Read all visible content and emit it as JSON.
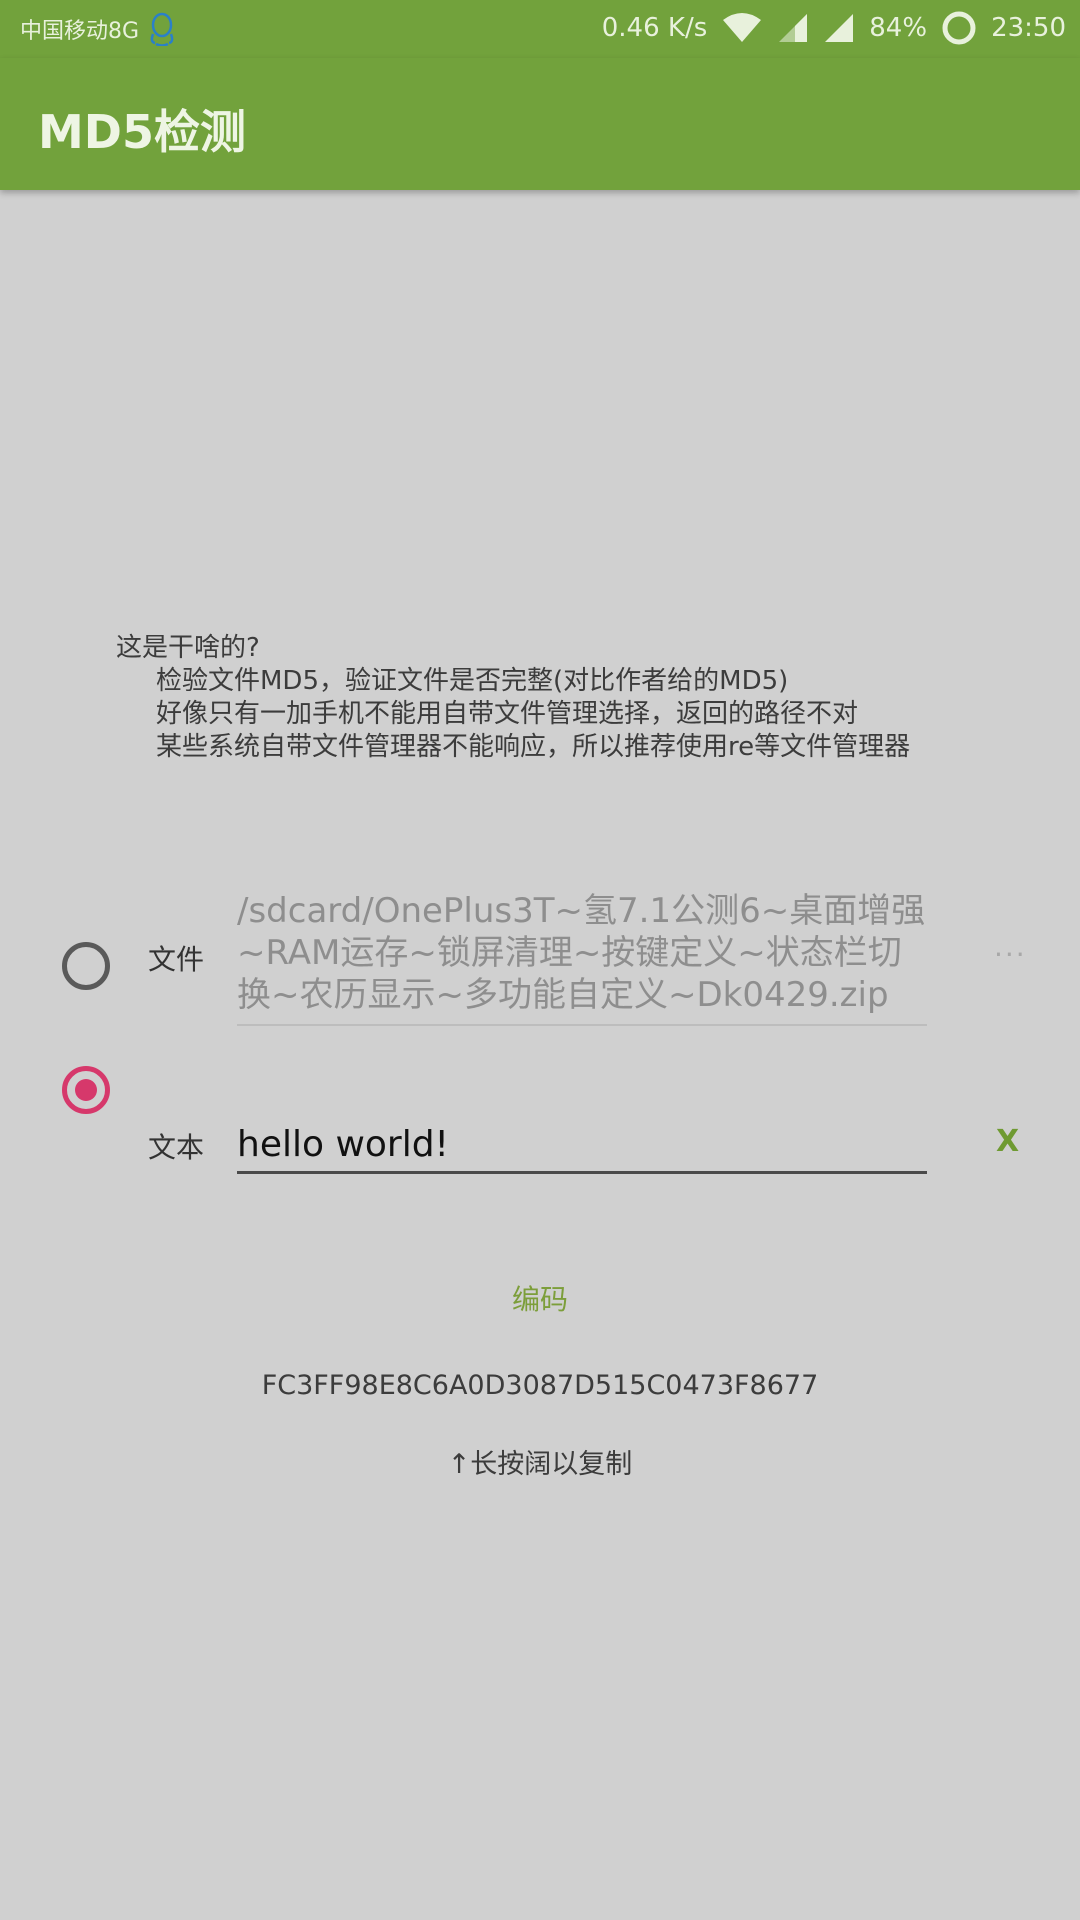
{
  "status_bar": {
    "carrier": "中国移动8G",
    "speed": "0.46 K/s",
    "battery": "84%",
    "time": "23:50",
    "icons": [
      "qq-icon",
      "wifi-icon",
      "signal-icon",
      "signal-icon",
      "battery-ring-icon"
    ]
  },
  "toolbar": {
    "title": "MD5检测"
  },
  "description": {
    "question": "这是干啥的?",
    "lines": [
      "检验文件MD5，验证文件是否完整(对比作者给的MD5)",
      "好像只有一加手机不能用自带文件管理选择，返回的路径不对",
      "某些系统自带文件管理器不能响应，所以推荐使用re等文件管理器"
    ]
  },
  "file_option": {
    "label": "文件",
    "value": "/sdcard/OnePlus3T~氢7.1公测6~桌面增强~RAM运存~锁屏清理~按键定义~状态栏切换~农历显示~多功能自定义~Dk0429.zip",
    "more": "···",
    "selected": false
  },
  "text_option": {
    "label": "文本",
    "value": "hello world!",
    "clear": "X",
    "selected": true
  },
  "encode_button": "编码",
  "result_hash": "FC3FF98E8C6A0D3087D515C0473F8677",
  "copy_hint": "↑长按阔以复制",
  "colors": {
    "primary": "#72a23c",
    "accent": "#d6386b",
    "background": "#d0d0d0"
  }
}
